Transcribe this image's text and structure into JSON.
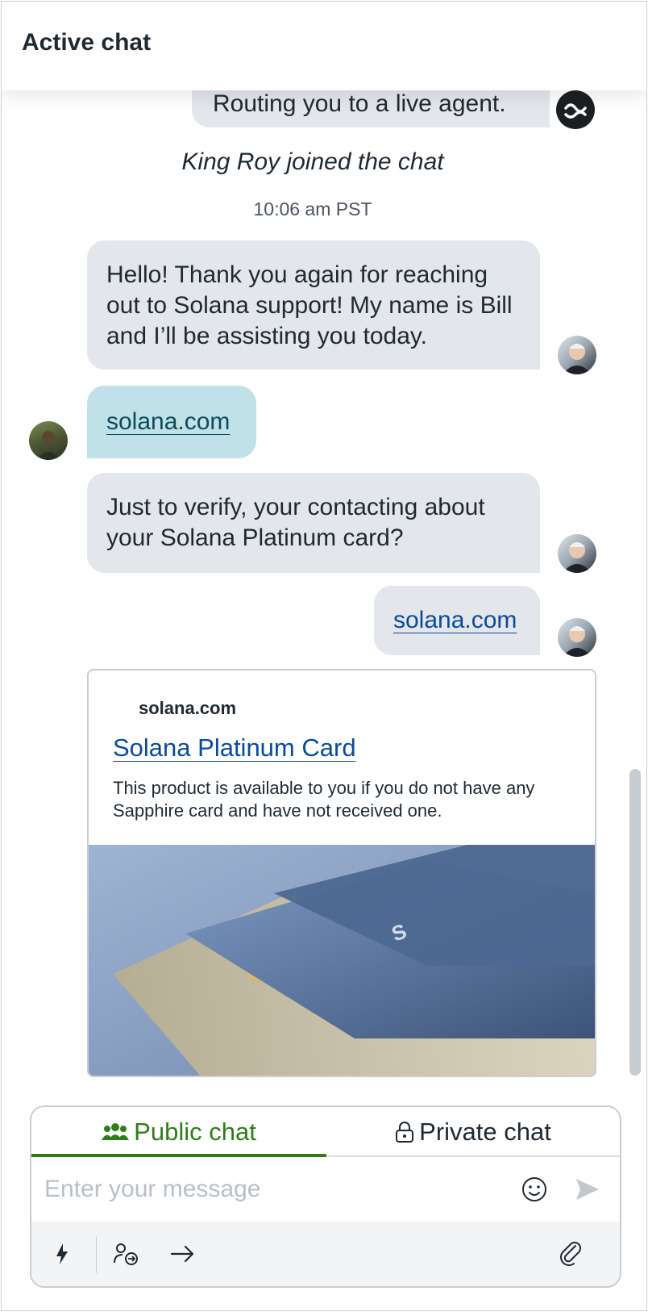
{
  "header": {
    "title": "Active chat"
  },
  "messages": {
    "bot_routing": "Routing you to a live agent.",
    "join_event": "King Roy joined the chat",
    "join_time": "10:06 am PST",
    "agent_greeting": "Hello! Thank you again for reaching out to Solana support! My name is Bill and I’ll be assisting you today.",
    "user_link": "solana.com",
    "agent_verify": "Just to verify, your contacting about your Solana Platinum card?",
    "agent_link": "solana.com"
  },
  "link_card": {
    "domain": "solana.com",
    "title": "Solana Platinum Card",
    "description": "This product is available to you if you do not have any Sapphire card and have not received one.",
    "image_icon": "credit-cards-photo"
  },
  "composer": {
    "tabs": [
      {
        "label": "Public chat",
        "icon": "people-icon",
        "active": true
      },
      {
        "label": "Private chat",
        "icon": "lock-icon",
        "active": false
      }
    ],
    "placeholder": "Enter your message",
    "icons": [
      "emoji-icon",
      "send-icon",
      "lightning-icon",
      "transfer-icon",
      "arrow-right-icon",
      "paperclip-icon"
    ]
  },
  "colors": {
    "accent_green": "#2e7d1a",
    "link_blue": "#0b4a9a",
    "bubble_gray": "#e3e6ea",
    "bubble_blue": "#bfe1e7"
  }
}
